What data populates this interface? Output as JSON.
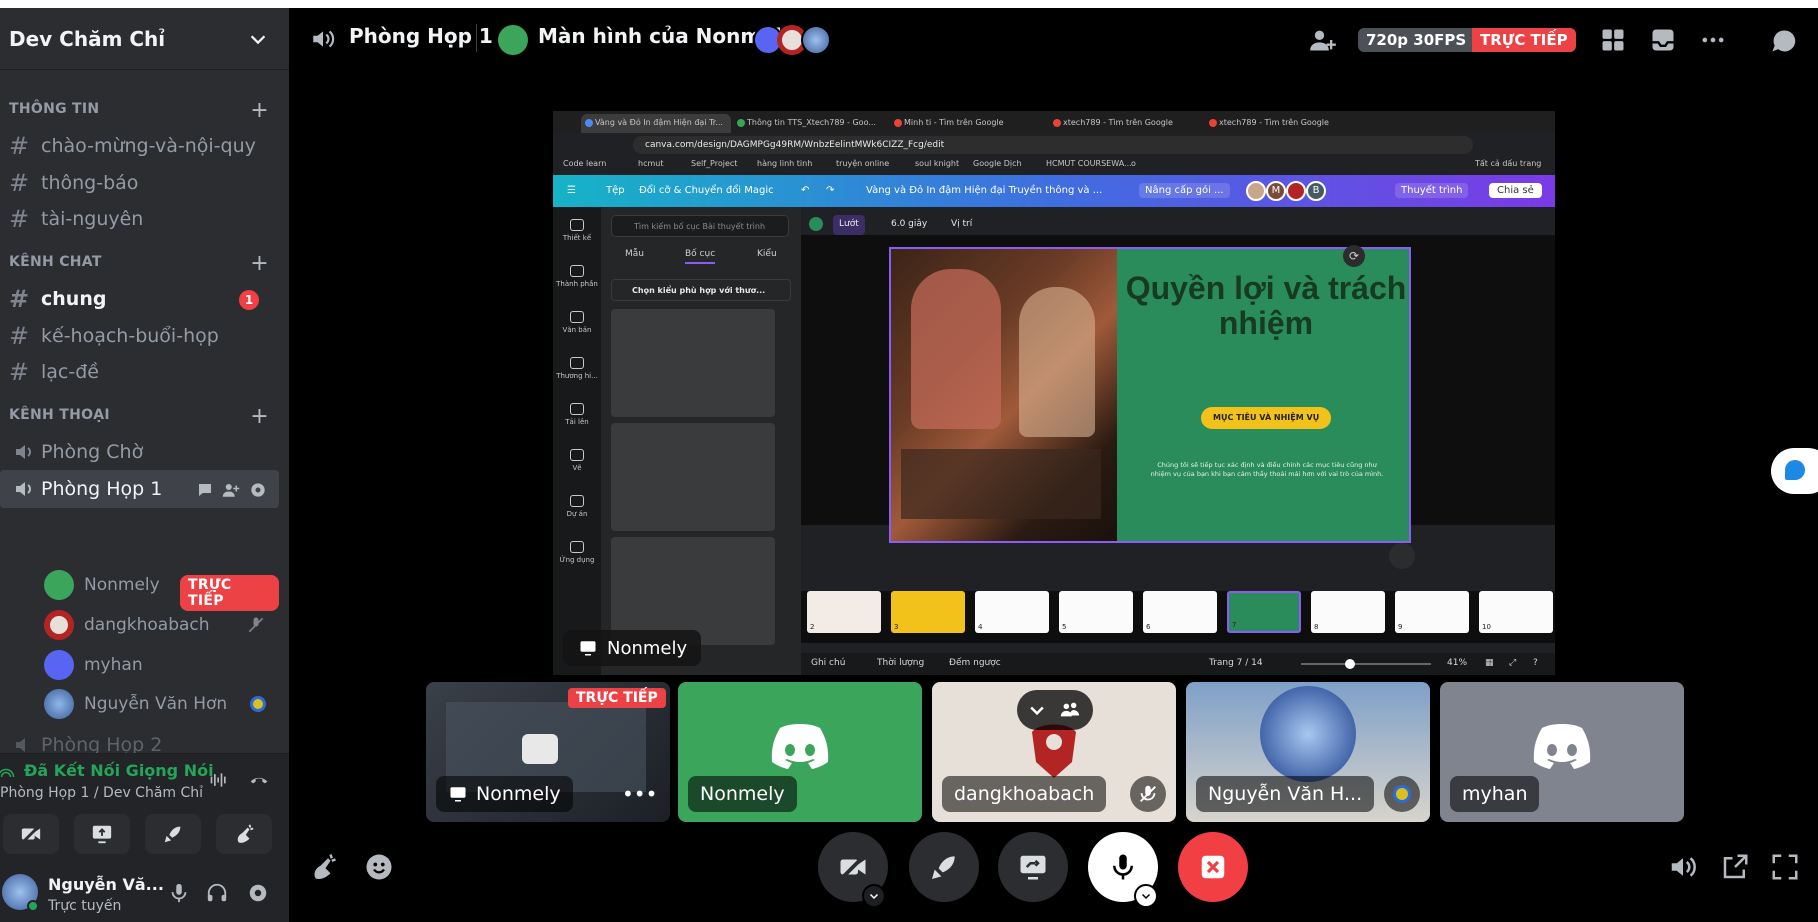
{
  "server": {
    "name": "Dev Chăm Chỉ"
  },
  "categories": {
    "info": "THÔNG TIN",
    "chat": "KÊNH CHAT",
    "voice": "KÊNH THOẠI"
  },
  "text_channels_info": [
    "chào-mừng-và-nội-quy",
    "thông-báo",
    "tài-nguyên"
  ],
  "text_channels_chat": [
    {
      "name": "chung",
      "unread": "1"
    },
    {
      "name": "kế-hoạch-buổi-họp"
    },
    {
      "name": "lạc-đề"
    }
  ],
  "voice_channels": {
    "waiting": "Phòng Chờ",
    "active": "Phòng Họp 1",
    "partial_next": "Phòng Họp 2"
  },
  "voice_members": [
    {
      "name": "Nonmely",
      "badge": "TRỰC TIẾP"
    },
    {
      "name": "dangkhoabach"
    },
    {
      "name": "myhan"
    },
    {
      "name": "Nguyễn Văn Hơn"
    }
  ],
  "voice_panel": {
    "status": "Đã Kết Nối Giọng Nói",
    "location": "Phòng Họp 1 / Dev Chăm Chỉ"
  },
  "user": {
    "name": "Nguyễn Vă...",
    "status": "Trực tuyến"
  },
  "topbar": {
    "channel": "Phòng Họp 1",
    "stream_title": "Màn hình của Nonmely",
    "quality": "720p 30FPS",
    "live": "TRỰC TIẾP"
  },
  "browser": {
    "tabs": [
      "Vàng và Đỏ In đậm Hiện đại Tr...",
      "Thông tin TTS_Xtech789 - Goo...",
      "Minh ti - Tìm trên Google",
      "xtech789 - Tìm trên Google",
      "xtech789 - Tìm trên Google"
    ],
    "url": "canva.com/design/DAGMPGg49RM/WnbzEelintMWk6CIZZ_Fcg/edit",
    "bookmarks": [
      "Code learn",
      "hcmut",
      "Self_Project",
      "hàng linh tinh",
      "truyện online",
      "soul knight",
      "Google Dịch",
      "HCMUT COURSEWA...",
      "o",
      "Tất cả dấu trang"
    ]
  },
  "canva": {
    "menu": [
      "Tệp",
      "Đổi cỡ & Chuyển đổi Magic"
    ],
    "doc_title": "Vàng và Đỏ In đậm Hiện đại Truyền thông và ...",
    "upgrade": "Nâng cấp gói ...",
    "present": "Thuyết trình",
    "share": "Chia sẻ",
    "avatar_letters": [
      "M",
      "B"
    ],
    "side_items": [
      "Thiết kế",
      "Thành phần",
      "Văn bản",
      "Thương hi...",
      "Tải lên",
      "Vẽ",
      "Dự án",
      "Ứng dụng"
    ],
    "search_placeholder": "Tìm kiếm bố cục Bài thuyết trình",
    "panel_tabs": [
      "Mẫu",
      "Bố cục",
      "Kiểu"
    ],
    "panel_select": "Chọn kiểu phù hợp với thươ...",
    "tools": [
      "Lướt",
      "6.0 giây",
      "Vị trí"
    ],
    "slide_title": "Quyền lợi và trách nhiệm",
    "slide_button": "MỤC TIÊU VÀ NHIỆM VỤ",
    "slide_body": "Chúng tôi sẽ tiếp tục xác định và điều chỉnh các mục tiêu cũng như nhiệm vụ của bạn khi bạn cảm thấy thoải mái hơn với vai trò của mình.",
    "film_numbers": [
      "2",
      "3",
      "4",
      "5",
      "6",
      "7",
      "8",
      "9",
      "10"
    ],
    "footer": [
      "Ghi chú",
      "Thời lượng",
      "Đếm ngược"
    ],
    "page": "Trang 7 / 14",
    "zoom": "41%",
    "zoom_fraction": 0.38
  },
  "screen_owner": "Nonmely",
  "tiles": [
    {
      "name": "Nonmely",
      "badge": "TRỰC TIẾP"
    },
    {
      "name": "Nonmely"
    },
    {
      "name": "dangkhoabach"
    },
    {
      "name": "Nguyễn Văn H..."
    },
    {
      "name": "myhan"
    }
  ],
  "colors": {
    "live_red": "#ed4245",
    "connected_green": "#23a55a",
    "discord_green": "#3ba55c",
    "hangup_red": "#f23f43"
  }
}
